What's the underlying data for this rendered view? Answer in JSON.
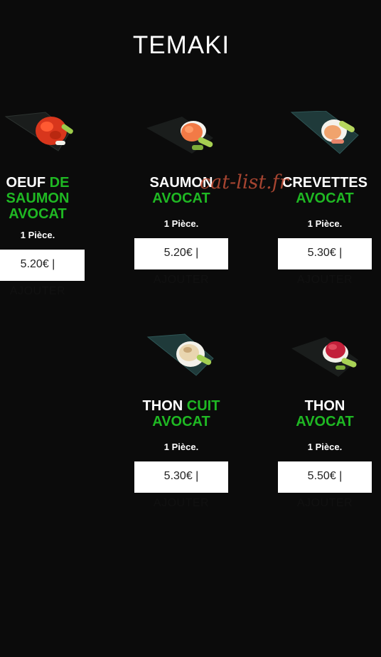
{
  "page": {
    "title": "TEMAKI"
  },
  "watermark": "cat-list.fr",
  "products": [
    {
      "name_white": "OEUF",
      "name_green_1": "DE",
      "name_green_2": "SAUMON",
      "name_green_3": "AVOCAT",
      "pieces": "1 Pièce.",
      "price": "5.20€ |",
      "add_label": "AJOUTER",
      "image_icon": "temaki-oeuf-saumon-image"
    },
    {
      "name_white": "SAUMON",
      "name_green": "AVOCAT",
      "pieces": "1 Pièce.",
      "price": "5.20€ |",
      "add_label": "AJOUTER",
      "image_icon": "temaki-saumon-image"
    },
    {
      "name_white": "CREVETTES",
      "name_green": "AVOCAT",
      "pieces": "1 Pièce.",
      "price": "5.30€ |",
      "add_label": "AJOUTER",
      "image_icon": "temaki-crevettes-image"
    },
    {
      "name_white": "THON",
      "name_green_1": "CUIT",
      "name_green_2": "AVOCAT",
      "pieces": "1 Pièce.",
      "price": "5.30€ |",
      "add_label": "AJOUTER",
      "image_icon": "temaki-thon-cuit-image"
    },
    {
      "name_white": "THON",
      "name_green": "AVOCAT",
      "pieces": "1 Pièce.",
      "price": "5.50€ |",
      "add_label": "AJOUTER",
      "image_icon": "temaki-thon-image"
    }
  ],
  "colors": {
    "background": "#0b0b0b",
    "accent_green": "#1fb823",
    "text": "#ffffff",
    "button_bg": "#ffffff"
  }
}
